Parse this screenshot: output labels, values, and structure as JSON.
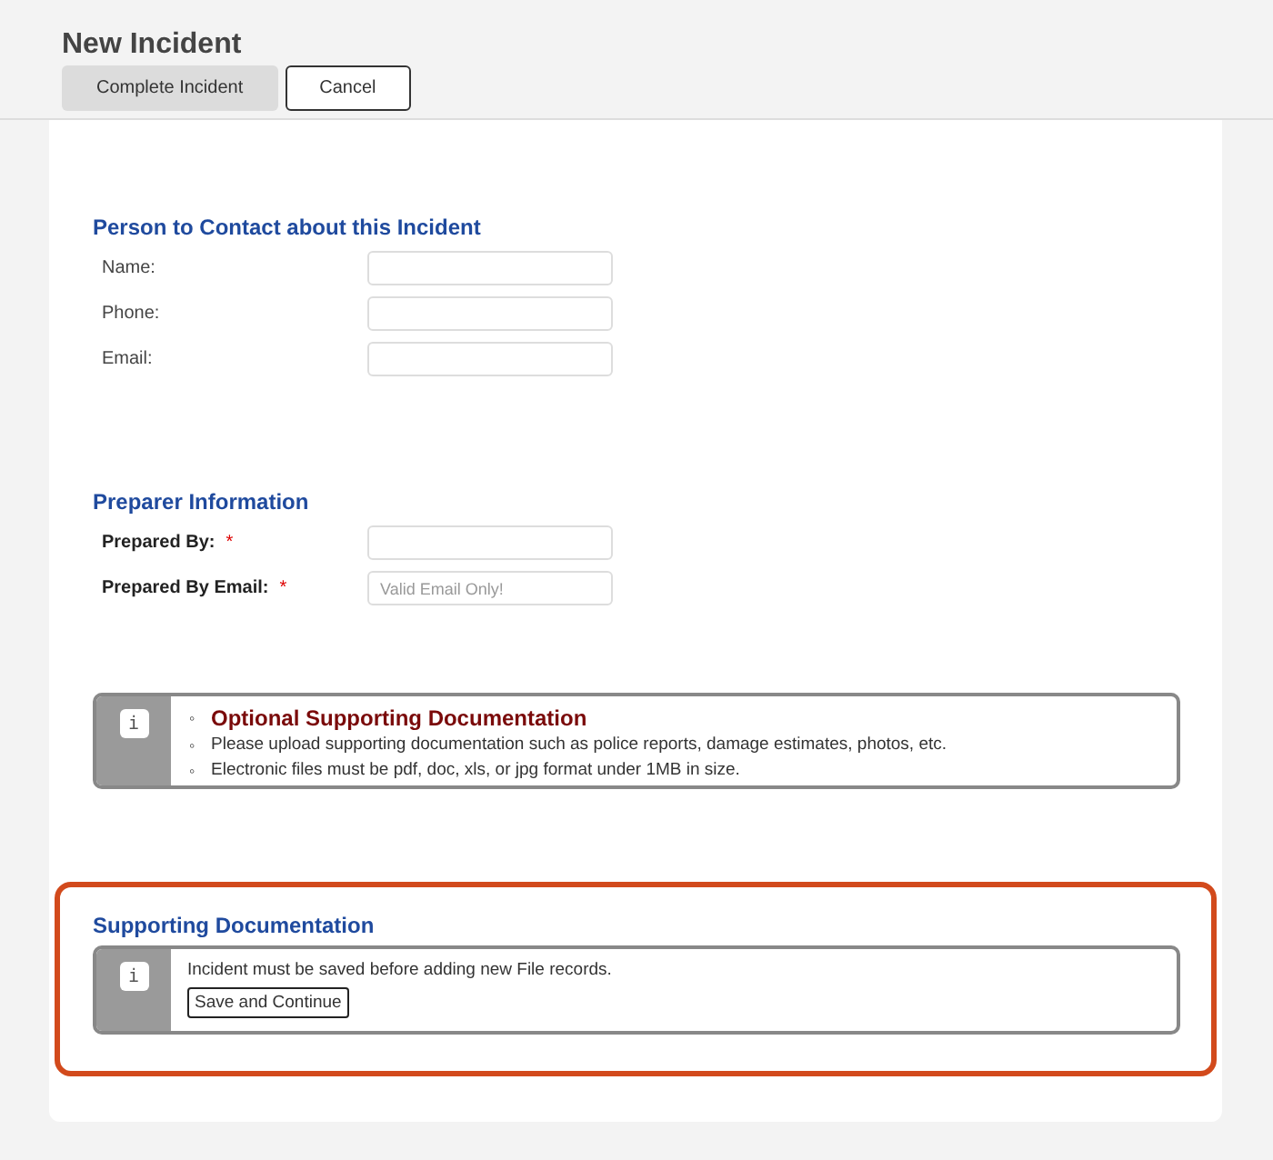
{
  "page_title": "New Incident",
  "toolbar": [
    {
      "label": "Complete Incident",
      "kind": "filled"
    },
    {
      "label": "Cancel",
      "kind": "outline"
    }
  ],
  "contact_section": {
    "title": "Person to Contact about this Incident",
    "fields": [
      {
        "label": "Name:"
      },
      {
        "label": "Phone:"
      },
      {
        "label": "Email:"
      }
    ]
  },
  "preparer_section": {
    "title": "Preparer Information",
    "fields": [
      {
        "label": "Prepared By:",
        "required": true,
        "required_mark": "*"
      },
      {
        "label": "Prepared By Email:",
        "required": true,
        "required_mark": "*",
        "placeholder": "Valid Email Only!"
      }
    ]
  },
  "info_box": {
    "icon": "i",
    "items": [
      {
        "marker": "◦",
        "text": "Optional Supporting Documentation",
        "kind": "title"
      },
      {
        "marker": "◦",
        "text": "Please upload supporting documentation such as police reports, damage estimates, photos, etc.",
        "kind": "text"
      },
      {
        "marker": "◦",
        "text": "Electronic files must be pdf, doc, xls, or jpg format under 1MB in size.",
        "kind": "text"
      }
    ]
  },
  "supporting_section": {
    "title": "Supporting Documentation",
    "highlighted": true,
    "icon": "i",
    "message": "Incident must be saved before adding new File records.",
    "button": "Save and Continue"
  }
}
